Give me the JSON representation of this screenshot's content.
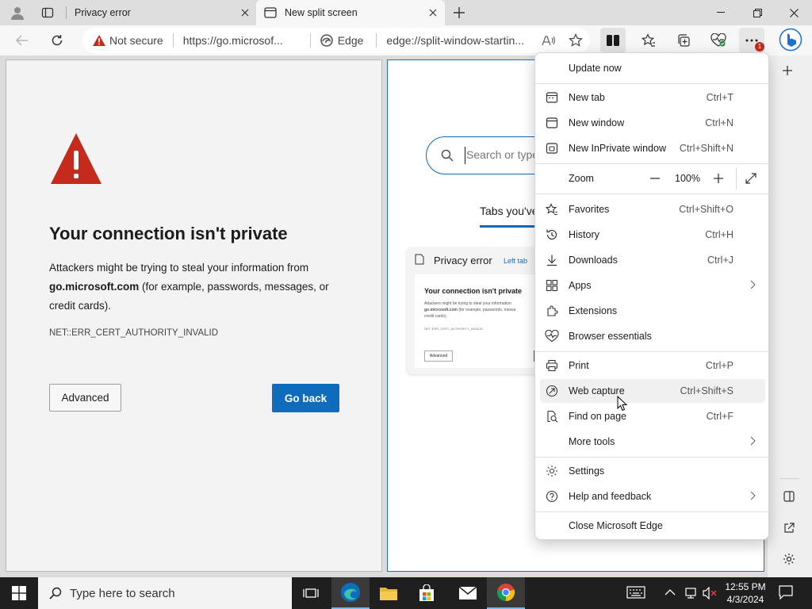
{
  "tabs": [
    {
      "title": "Privacy error",
      "icon": "page-icon"
    },
    {
      "title": "New split screen",
      "icon": "split-tab-icon"
    }
  ],
  "address": {
    "security": "Not secure",
    "left_url": "https://go.microsof...",
    "edge_label": "Edge",
    "right_url": "edge://split-window-startin..."
  },
  "left_page": {
    "title": "Your connection isn't private",
    "desc_prefix": "Attackers might be trying to steal your information from",
    "domain": "go.microsoft.com",
    "desc_suffix": "(for example, passwords, messages, or credit cards).",
    "error_code": "NET::ERR_CERT_AUTHORITY_INVALID",
    "advanced": "Advanced",
    "go_back": "Go back"
  },
  "right_page": {
    "search_placeholder": "Search or type",
    "tabs_heading": "Tabs you've",
    "card_title": "Privacy error",
    "card_badge": "Left tab",
    "thumb_title": "Your connection isn't private",
    "thumb_line1": "Attackers might be trying to steal your information",
    "thumb_line2a": "go.microsoft.com",
    "thumb_line2b": "(for example, passwords, messa",
    "thumb_line3": "credit cards).",
    "thumb_code": "NET::ERR_CERT_AUTHORITY_INVALID",
    "thumb_button": "Advanced"
  },
  "menu": {
    "update": "Update now",
    "new_tab": {
      "label": "New tab",
      "shortcut": "Ctrl+T"
    },
    "new_window": {
      "label": "New window",
      "shortcut": "Ctrl+N"
    },
    "inprivate": {
      "label": "New InPrivate window",
      "shortcut": "Ctrl+Shift+N"
    },
    "zoom": {
      "label": "Zoom",
      "value": "100%"
    },
    "favorites": {
      "label": "Favorites",
      "shortcut": "Ctrl+Shift+O"
    },
    "history": {
      "label": "History",
      "shortcut": "Ctrl+H"
    },
    "downloads": {
      "label": "Downloads",
      "shortcut": "Ctrl+J"
    },
    "apps": {
      "label": "Apps"
    },
    "extensions": {
      "label": "Extensions"
    },
    "essentials": {
      "label": "Browser essentials"
    },
    "print": {
      "label": "Print",
      "shortcut": "Ctrl+P"
    },
    "web_capture": {
      "label": "Web capture",
      "shortcut": "Ctrl+Shift+S"
    },
    "find": {
      "label": "Find on page",
      "shortcut": "Ctrl+F"
    },
    "more_tools": {
      "label": "More tools"
    },
    "settings": {
      "label": "Settings"
    },
    "help": {
      "label": "Help and feedback"
    },
    "close": {
      "label": "Close Microsoft Edge"
    }
  },
  "notification_badge": "1",
  "taskbar": {
    "search_placeholder": "Type here to search",
    "time": "12:55 PM",
    "date": "4/3/2024"
  },
  "colors": {
    "accent": "#0f6cbd",
    "warning_red": "#c42b1c",
    "taskbar": "#1f1f1f"
  }
}
